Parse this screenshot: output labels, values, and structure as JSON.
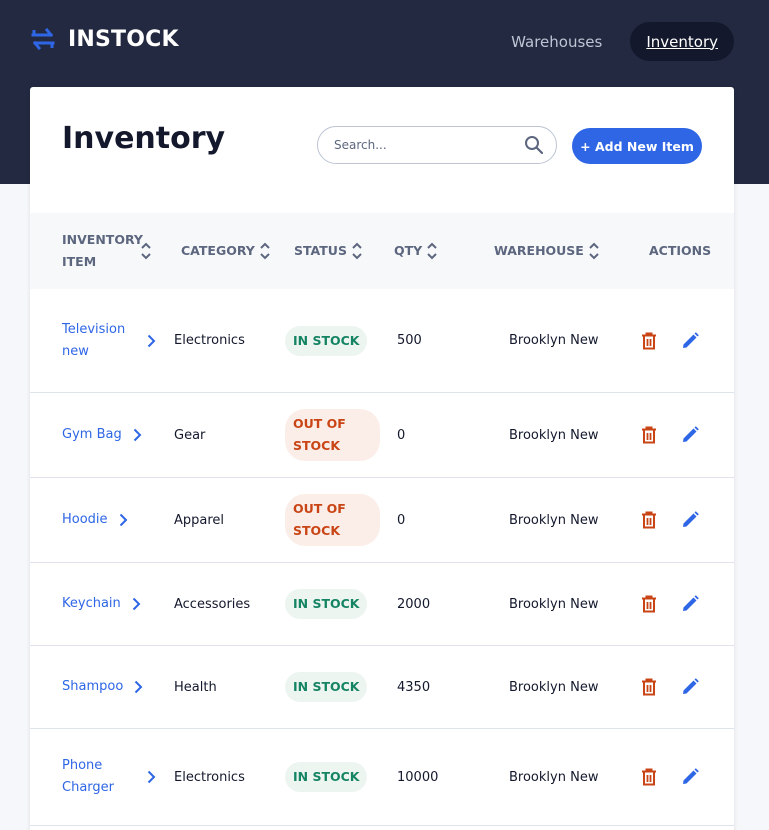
{
  "app": {
    "logo_text": "INSTOCK",
    "nav": [
      {
        "label": "Warehouses",
        "active": false
      },
      {
        "label": "Inventory",
        "active": true
      }
    ]
  },
  "page": {
    "title": "Inventory",
    "search_placeholder": "Search...",
    "add_button_label": "+ Add New Item"
  },
  "table": {
    "columns": [
      "INVENTORY ITEM",
      "CATEGORY",
      "STATUS",
      "QTY",
      "WAREHOUSE",
      "ACTIONS"
    ],
    "rows": [
      {
        "item": "Television new",
        "category": "Electronics",
        "status": "IN STOCK",
        "qty": "500",
        "warehouse": "Brooklyn New"
      },
      {
        "item": "Gym Bag",
        "category": "Gear",
        "status": "OUT OF STOCK",
        "qty": "0",
        "warehouse": "Brooklyn New"
      },
      {
        "item": "Hoodie",
        "category": "Apparel",
        "status": "OUT OF STOCK",
        "qty": "0",
        "warehouse": "Brooklyn New"
      },
      {
        "item": "Keychain",
        "category": "Accessories",
        "status": "IN STOCK",
        "qty": "2000",
        "warehouse": "Brooklyn New"
      },
      {
        "item": "Shampoo",
        "category": "Health",
        "status": "IN STOCK",
        "qty": "4350",
        "warehouse": "Brooklyn New"
      },
      {
        "item": "Phone Charger",
        "category": "Electronics",
        "status": "IN STOCK",
        "qty": "10000",
        "warehouse": "Brooklyn New"
      }
    ]
  },
  "icons": {
    "logo": "swap-arrows-icon",
    "search": "search-icon",
    "sort": "sort-icon",
    "chevron": "chevron-right-icon",
    "delete": "trash-icon",
    "edit": "pencil-icon"
  },
  "colors": {
    "header_bg": "#232940",
    "primary": "#2e66e5",
    "in_stock_text": "#158463",
    "in_stock_bg": "#edf5f1",
    "out_stock_text": "#c94515",
    "out_stock_bg": "#fbeee8"
  }
}
